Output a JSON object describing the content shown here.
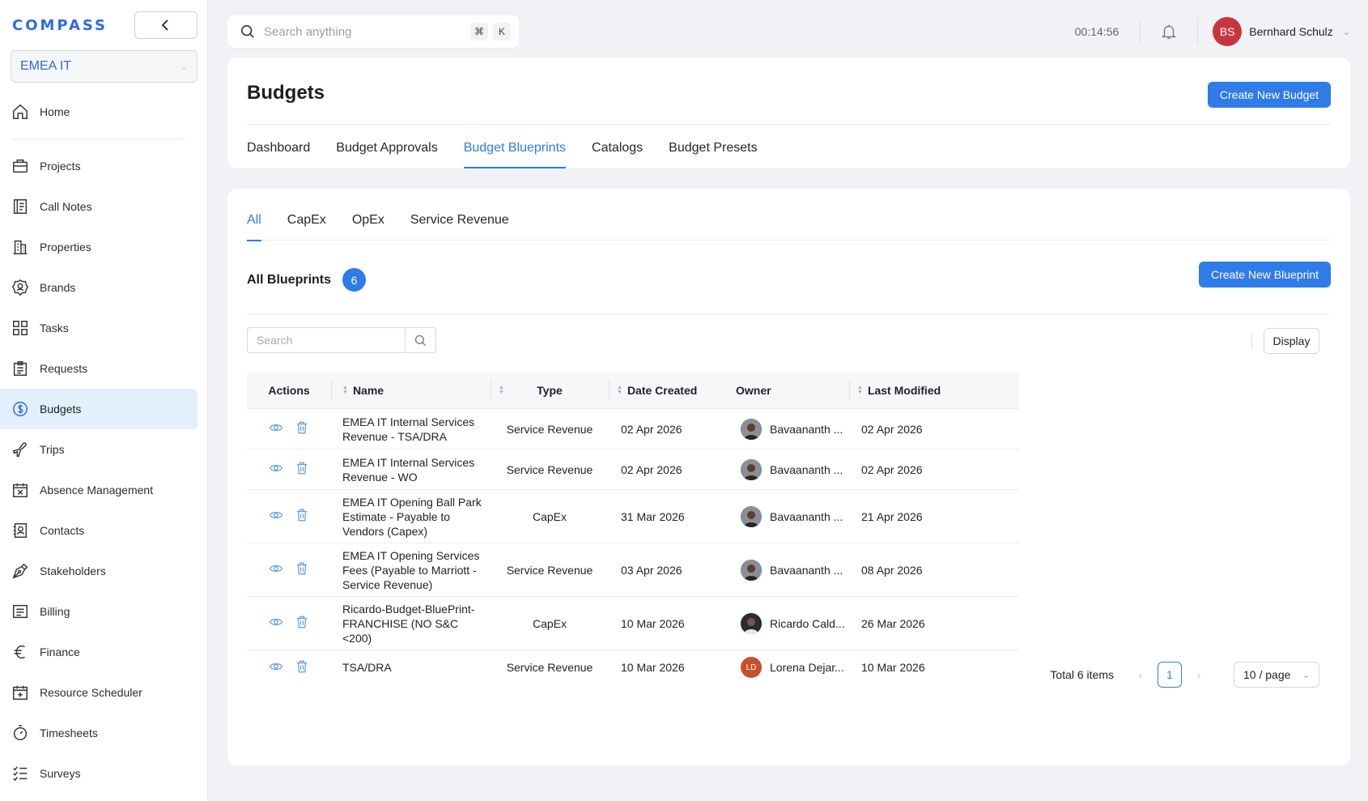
{
  "app": {
    "logo": "COMPASS",
    "org": "EMEA IT"
  },
  "sidebar": {
    "items": [
      {
        "label": "Home",
        "icon": "home-icon"
      },
      {
        "label": "Projects",
        "icon": "briefcase-icon"
      },
      {
        "label": "Call Notes",
        "icon": "notebook-icon"
      },
      {
        "label": "Properties",
        "icon": "building-icon"
      },
      {
        "label": "Brands",
        "icon": "badge-icon"
      },
      {
        "label": "Tasks",
        "icon": "grid-icon"
      },
      {
        "label": "Requests",
        "icon": "clipboard-icon"
      },
      {
        "label": "Budgets",
        "icon": "dollar-circle-icon"
      },
      {
        "label": "Trips",
        "icon": "plane-icon"
      },
      {
        "label": "Absence Management",
        "icon": "calendar-x-icon"
      },
      {
        "label": "Contacts",
        "icon": "contact-book-icon"
      },
      {
        "label": "Stakeholders",
        "icon": "pen-nib-icon"
      },
      {
        "label": "Billing",
        "icon": "billing-icon"
      },
      {
        "label": "Finance",
        "icon": "euro-icon"
      },
      {
        "label": "Resource Scheduler",
        "icon": "calendar-plus-icon"
      },
      {
        "label": "Timesheets",
        "icon": "stopwatch-icon"
      },
      {
        "label": "Surveys",
        "icon": "checklist-icon"
      }
    ],
    "active": "Budgets"
  },
  "topbar": {
    "search_placeholder": "Search anything",
    "kbd_cmd": "⌘",
    "kbd_k": "K",
    "timer": "00:14:56",
    "user_initials": "BS",
    "user_name": "Bernhard Schulz"
  },
  "header": {
    "title": "Budgets",
    "create_button": "Create New Budget",
    "tabs": [
      "Dashboard",
      "Budget Approvals",
      "Budget Blueprints",
      "Catalogs",
      "Budget Presets"
    ],
    "active_tab": "Budget Blueprints"
  },
  "blueprints": {
    "subtabs": [
      "All",
      "CapEx",
      "OpEx",
      "Service Revenue"
    ],
    "active_subtab": "All",
    "title": "All Blueprints",
    "count": "6",
    "create_button": "Create New Blueprint",
    "search_placeholder": "Search",
    "display_button": "Display",
    "columns": {
      "actions": "Actions",
      "name": "Name",
      "type": "Type",
      "date_created": "Date Created",
      "owner": "Owner",
      "last_modified": "Last Modified"
    },
    "rows": [
      {
        "name": "EMEA IT Internal Services Revenue - TSA/DRA",
        "type": "Service Revenue",
        "date_created": "02 Apr 2026",
        "owner": "Bavaananth ...",
        "owner_avatar": "photo",
        "last_modified": "02 Apr 2026"
      },
      {
        "name": "EMEA IT Internal Services Revenue - WO",
        "type": "Service Revenue",
        "date_created": "02 Apr 2026",
        "owner": "Bavaananth ...",
        "owner_avatar": "photo",
        "last_modified": "02 Apr 2026"
      },
      {
        "name": "EMEA IT Opening Ball Park Estimate - Payable to Vendors (Capex)",
        "type": "CapEx",
        "date_created": "31 Mar 2026",
        "owner": "Bavaananth ...",
        "owner_avatar": "photo",
        "last_modified": "21 Apr 2026"
      },
      {
        "name": "EMEA IT Opening Services Fees (Payable to Marriott - Service Revenue)",
        "type": "Service Revenue",
        "date_created": "03 Apr 2026",
        "owner": "Bavaananth ...",
        "owner_avatar": "photo",
        "last_modified": "08 Apr 2026"
      },
      {
        "name": "Ricardo-Budget-BluePrint-FRANCHISE (NO S&C <200)",
        "type": "CapEx",
        "date_created": "10 Mar 2026",
        "owner": "Ricardo Cald...",
        "owner_avatar": "photo",
        "last_modified": "26 Mar 2026"
      },
      {
        "name": "TSA/DRA",
        "type": "Service Revenue",
        "date_created": "10 Mar 2026",
        "owner": "Lorena Dejar...",
        "owner_avatar": "LD",
        "last_modified": "10 Mar 2026"
      }
    ],
    "pagination": {
      "total": "Total 6 items",
      "current_page": "1",
      "page_size": "10 / page"
    }
  },
  "colors": {
    "accent": "#2f7be8",
    "active_nav_bg": "#e3f0fc",
    "user_avatar": "#c9353e",
    "owner_ld_avatar": "#c7502e"
  }
}
